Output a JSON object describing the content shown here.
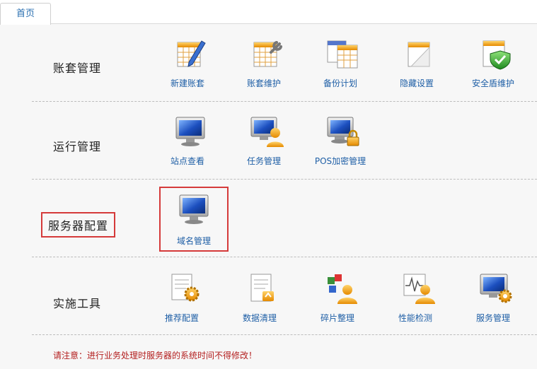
{
  "tabs": [
    {
      "label": "首页"
    }
  ],
  "sections": [
    {
      "title": "账套管理",
      "items": [
        {
          "label": "新建账套",
          "icon": "calendar-pencil-icon"
        },
        {
          "label": "账套维护",
          "icon": "calendar-wrench-icon"
        },
        {
          "label": "备份计划",
          "icon": "calendars-icon"
        },
        {
          "label": "隐藏设置",
          "icon": "hidden-page-icon"
        },
        {
          "label": "安全盾维护",
          "icon": "shield-check-icon"
        }
      ]
    },
    {
      "title": "运行管理",
      "items": [
        {
          "label": "站点查看",
          "icon": "monitor-icon"
        },
        {
          "label": "任务管理",
          "icon": "monitor-user-icon"
        },
        {
          "label": "POS加密管理",
          "icon": "monitor-lock-icon"
        }
      ]
    },
    {
      "title": "服务器配置",
      "items": [
        {
          "label": "域名管理",
          "icon": "monitor-icon"
        }
      ]
    },
    {
      "title": "实施工具",
      "items": [
        {
          "label": "推荐配置",
          "icon": "document-gear-icon"
        },
        {
          "label": "数据清理",
          "icon": "document-arrows-icon"
        },
        {
          "label": "碎片整理",
          "icon": "blocks-user-icon"
        },
        {
          "label": "性能检测",
          "icon": "pulse-user-icon"
        },
        {
          "label": "服务管理",
          "icon": "monitor-gear-icon"
        }
      ]
    }
  ],
  "notice": "请注意：进行业务处理时服务器的系统时间不得修改！",
  "colors": {
    "label_link": "#1f5fa6",
    "highlight": "#d53a3a",
    "notice": "#b31e1e"
  }
}
